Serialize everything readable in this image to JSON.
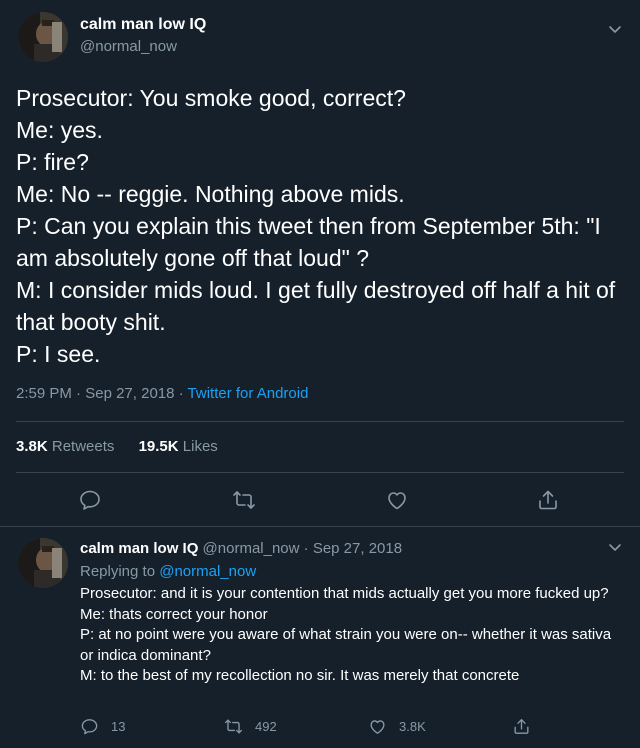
{
  "main_tweet": {
    "display_name": "calm man low IQ",
    "handle": "@normal_now",
    "text": "Prosecutor: You smoke good, correct?\nMe: yes.\nP: fire?\nMe: No -- reggie. Nothing above mids.\nP: Can you explain this tweet then from September 5th: \"I am absolutely gone off that loud\" ?\nM: I consider mids loud. I get fully destroyed off half a hit of that booty shit.\nP: I see.",
    "time": "2:59 PM",
    "date": "Sep 27, 2018",
    "client": "Twitter for Android",
    "separator": " · ",
    "retweets_count": "3.8K",
    "retweets_label": "Retweets",
    "likes_count": "19.5K",
    "likes_label": "Likes"
  },
  "reply_tweet": {
    "display_name": "calm man low IQ",
    "handle": "@normal_now",
    "separator": " · ",
    "date": "Sep 27, 2018",
    "replying_prefix": "Replying to",
    "replying_to": "@normal_now",
    "text": "Prosecutor: and it is your contention that mids actually get you more fucked up?\nMe: thats correct your honor\nP: at no point were you aware of what strain you were on-- whether it was sativa or indica dominant?\nM: to the best of my recollection no sir. It was merely that concrete",
    "reply_count": "13",
    "retweet_count": "492",
    "like_count": "3.8K"
  },
  "icons": {
    "reply": "reply-icon",
    "retweet": "retweet-icon",
    "like": "heart-icon",
    "share": "share-icon",
    "caret": "chevron-down-icon"
  },
  "colors": {
    "background": "#15202b",
    "text": "#ffffff",
    "muted": "#8899a6",
    "accent": "#1da1f2",
    "divider": "#38444d"
  }
}
